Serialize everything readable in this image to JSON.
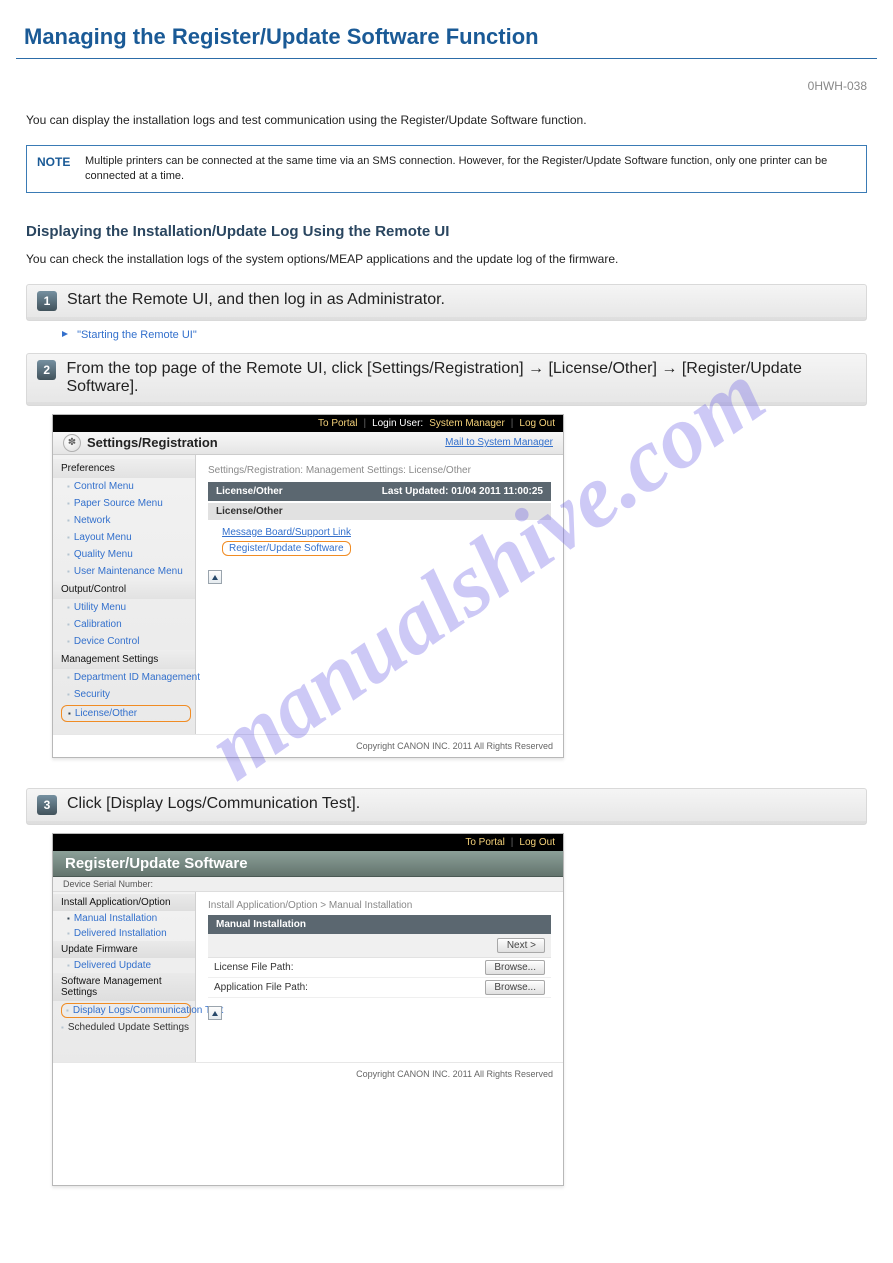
{
  "heading": "Managing the Register/Update Software Function",
  "intro": "0HWH-038",
  "note_label": "NOTE",
  "note_text": "Multiple printers can be connected at the same time via an SMS connection. However, for the Register/Update Software function, only one printer can be connected at a time.",
  "step1": {
    "num": "1",
    "title": "Start the Remote UI, and then log in as Administrator.",
    "sub_prefix": "\"Starting the Remote UI\"",
    "sub_rest": ""
  },
  "step2": {
    "num": "2",
    "title": "From the top page of the Remote UI, click [Settings/Registration] → [License/Other] → [Register/Update Software].",
    "screenshot": {
      "topbar_to_portal": "To Portal",
      "topbar_login": "Login User:",
      "topbar_user": "System Manager",
      "topbar_logout": "Log Out",
      "app_title": "Settings/Registration",
      "mail_link": "Mail to System Manager",
      "crumbs": "Settings/Registration: Management Settings: License/Other",
      "panel_title": "License/Other",
      "last_updated": "Last Updated: 01/04 2011 11:00:25",
      "sub_panel": "License/Other",
      "link_msgboard": "Message Board/Support Link",
      "link_regupd": "Register/Update Software",
      "copyright": "Copyright CANON INC. 2011 All Rights Reserved",
      "sidebar": {
        "cat_prefs": "Preferences",
        "items_prefs": [
          "Control Menu",
          "Paper Source Menu",
          "Network",
          "Layout Menu",
          "Quality Menu",
          "User Maintenance Menu"
        ],
        "cat_out": "Output/Control",
        "items_out": [
          "Utility Menu",
          "Calibration",
          "Device Control"
        ],
        "cat_mgmt": "Management Settings",
        "items_mgmt": [
          "Department ID Management",
          "Security",
          "License/Other"
        ]
      }
    }
  },
  "step3": {
    "num": "3",
    "title": "Click [Display Logs/Communication Test].",
    "screenshot": {
      "topbar_to_portal": "To Portal",
      "topbar_logout": "Log Out",
      "app_title": "Register/Update Software",
      "serial_label": "Device Serial Number:",
      "crumbs": "Install Application/Option > Manual Installation",
      "header": "Manual Installation",
      "next_btn": "Next >",
      "row_license": "License File Path:",
      "row_app": "Application File Path:",
      "browse_btn": "Browse...",
      "copyright": "Copyright CANON INC. 2011 All Rights Reserved",
      "sidebar": {
        "cat_install": "Install Application/Option",
        "items_install": [
          "Manual Installation",
          "Delivered Installation"
        ],
        "cat_fw": "Update Firmware",
        "items_fw": [
          "Delivered Update"
        ],
        "cat_sms": "Software Management Settings",
        "items_sms": [
          "Display Logs/Communication Test"
        ],
        "sched": "Scheduled Update Settings"
      }
    }
  },
  "watermark": "manualshive.com"
}
